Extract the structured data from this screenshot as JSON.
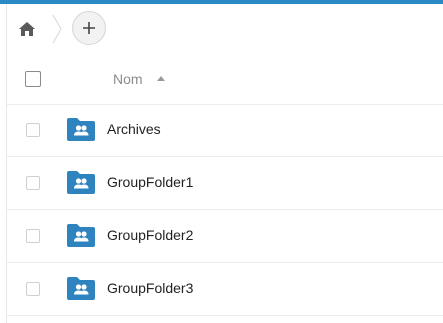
{
  "colors": {
    "accent": "#2b8ac6",
    "folder": "#2f84bf",
    "home": "#5a5a5a"
  },
  "toolbar": {
    "home_icon": "home-icon",
    "add_icon": "plus-icon",
    "add_glyph": "+"
  },
  "table": {
    "columns": {
      "name": "Nom",
      "sort": "ascending"
    },
    "rows": [
      {
        "name": "Archives",
        "icon": "group-folder-icon"
      },
      {
        "name": "GroupFolder1",
        "icon": "group-folder-icon"
      },
      {
        "name": "GroupFolder2",
        "icon": "group-folder-icon"
      },
      {
        "name": "GroupFolder3",
        "icon": "group-folder-icon"
      }
    ]
  }
}
